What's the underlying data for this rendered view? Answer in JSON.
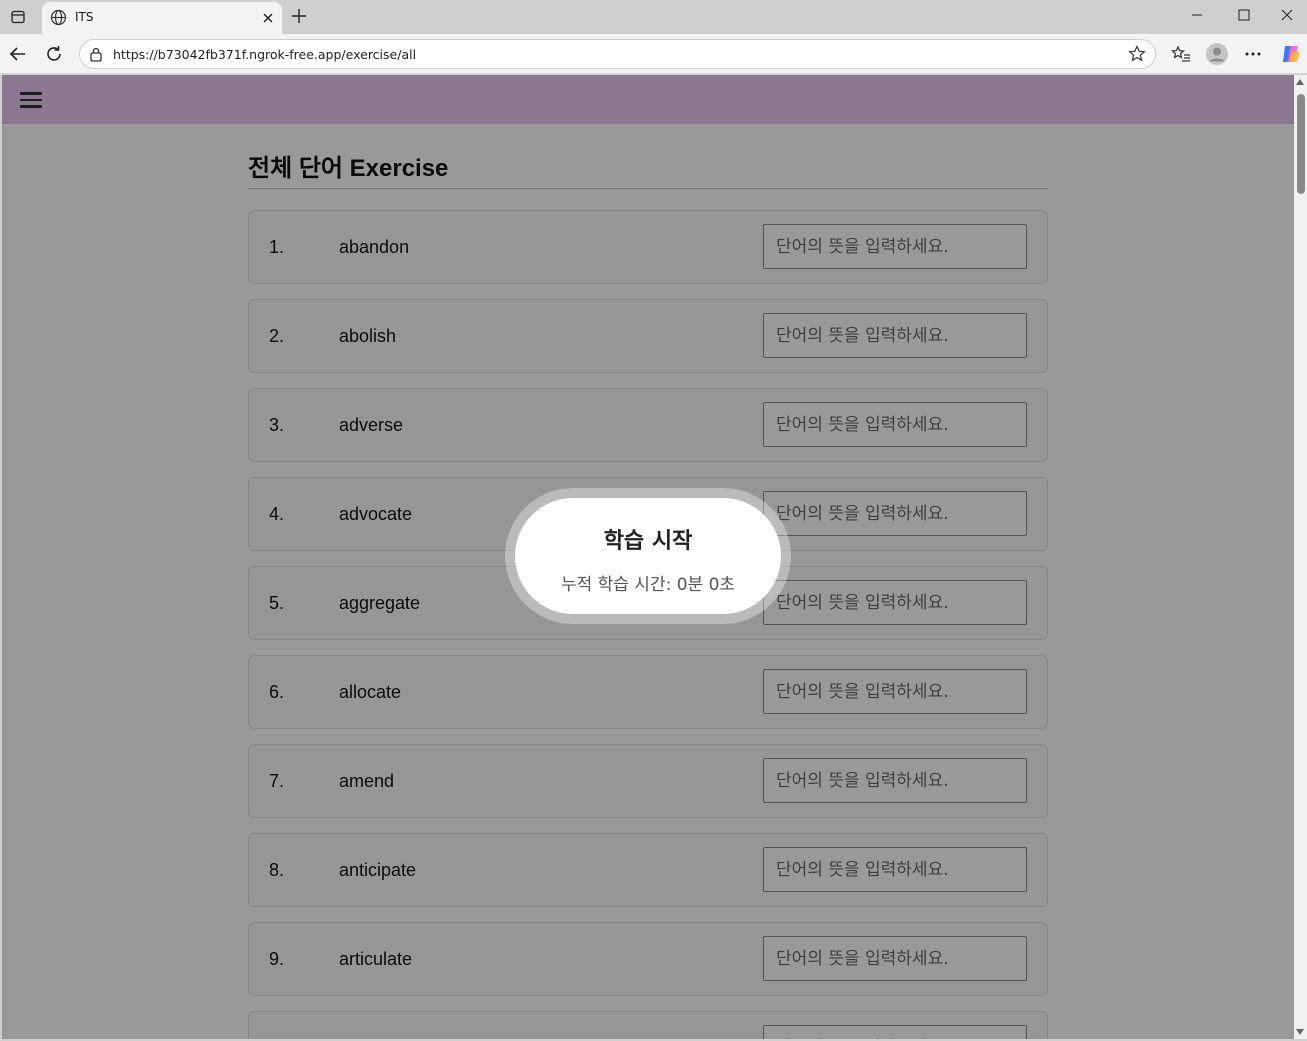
{
  "browser": {
    "tab_title": "ITS",
    "url": "https://b73042fb371f.ngrok-free.app/exercise/all"
  },
  "page": {
    "heading": "전체 단어 Exercise",
    "placeholder": "단어의 뜻을 입력하세요.",
    "words": [
      {
        "num": "1.",
        "word": "abandon"
      },
      {
        "num": "2.",
        "word": "abolish"
      },
      {
        "num": "3.",
        "word": "adverse"
      },
      {
        "num": "4.",
        "word": "advocate"
      },
      {
        "num": "5.",
        "word": "aggregate"
      },
      {
        "num": "6.",
        "word": "allocate"
      },
      {
        "num": "7.",
        "word": "amend"
      },
      {
        "num": "8.",
        "word": "anticipate"
      },
      {
        "num": "9.",
        "word": "articulate"
      },
      {
        "num": "",
        "word": ""
      }
    ]
  },
  "timer": {
    "title": "학습 시작",
    "elapsed": "누적 학습 시간: 0분 0초"
  },
  "colors": {
    "appbar": "#e6c9f1",
    "overlay": "rgba(0,0,0,0.4)"
  }
}
